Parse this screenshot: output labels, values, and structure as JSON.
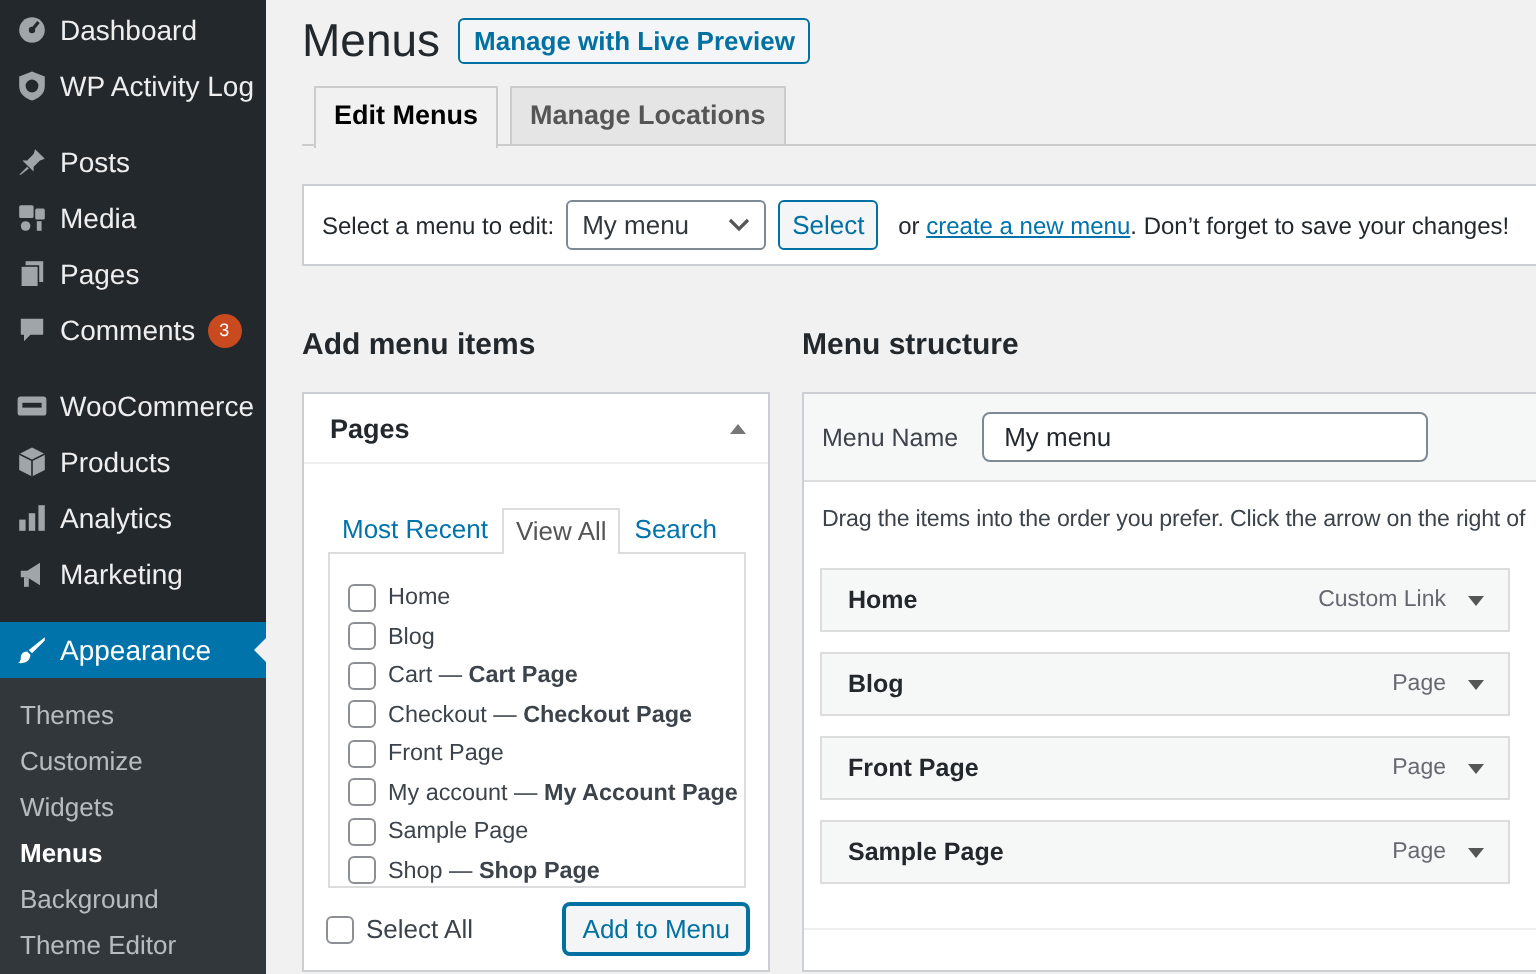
{
  "sidebar": {
    "groups": [
      {
        "items": [
          {
            "label": "Dashboard",
            "selected": false
          },
          {
            "label": "WP Activity Log",
            "selected": false
          }
        ]
      },
      {
        "items": [
          {
            "label": "Posts",
            "selected": false
          },
          {
            "label": "Media",
            "selected": false
          },
          {
            "label": "Pages",
            "selected": false
          },
          {
            "label": "Comments",
            "selected": false,
            "badge": "3"
          }
        ]
      },
      {
        "items": [
          {
            "label": "WooCommerce",
            "selected": false
          },
          {
            "label": "Products",
            "selected": false
          },
          {
            "label": "Analytics",
            "selected": false
          },
          {
            "label": "Marketing",
            "selected": false
          }
        ]
      },
      {
        "items": [
          {
            "label": "Appearance",
            "selected": true,
            "children": [
              {
                "label": "Themes",
                "selected": false
              },
              {
                "label": "Customize",
                "selected": false
              },
              {
                "label": "Widgets",
                "selected": false
              },
              {
                "label": "Menus",
                "selected": true
              },
              {
                "label": "Background",
                "selected": false
              },
              {
                "label": "Theme Editor",
                "selected": false
              }
            ]
          }
        ]
      }
    ]
  },
  "header": {
    "title": "Menus",
    "button": "Manage with Live Preview"
  },
  "tabs": [
    {
      "label": "Edit Menus",
      "selected": true
    },
    {
      "label": "Manage Locations",
      "selected": false
    }
  ],
  "menu_picker": {
    "label": "Select a menu to edit:",
    "value": "My menu",
    "button": "Select",
    "notice_before": "or",
    "notice_link": "create a new menu",
    "notice_after": ". Don’t forget to save your changes!"
  },
  "add_menu_items": {
    "heading": "Add menu items",
    "panel_title": "Pages",
    "tabs": [
      {
        "label": "Most Recent",
        "selected": false
      },
      {
        "label": "View All",
        "selected": true
      },
      {
        "label": "Search",
        "selected": false
      }
    ],
    "pages": [
      {
        "label": "Home",
        "checked": false
      },
      {
        "label": "Blog",
        "checked": false
      },
      {
        "label": "Cart — **Cart Page**",
        "checked": false
      },
      {
        "label": "Checkout — **Checkout Page**",
        "checked": false
      },
      {
        "label": "Front Page",
        "checked": false
      },
      {
        "label": "My account — **My Account Page**",
        "checked": false
      },
      {
        "label": "Sample Page",
        "checked": false
      },
      {
        "label": "Shop — **Shop Page**",
        "checked": false
      }
    ],
    "select_all": {
      "label": "Select All",
      "checked": false
    },
    "button": "Add to Menu"
  },
  "menu_structure": {
    "heading": "Menu structure",
    "name_label": "Menu Name",
    "name_value": "My menu",
    "instructions": "Drag the items into the order you prefer. Click the arrow on the right of",
    "items": [
      {
        "title": "Home",
        "type": "Custom Link"
      },
      {
        "title": "Blog",
        "type": "Page"
      },
      {
        "title": "Front Page",
        "type": "Page"
      },
      {
        "title": "Sample Page",
        "type": "Page"
      }
    ]
  }
}
